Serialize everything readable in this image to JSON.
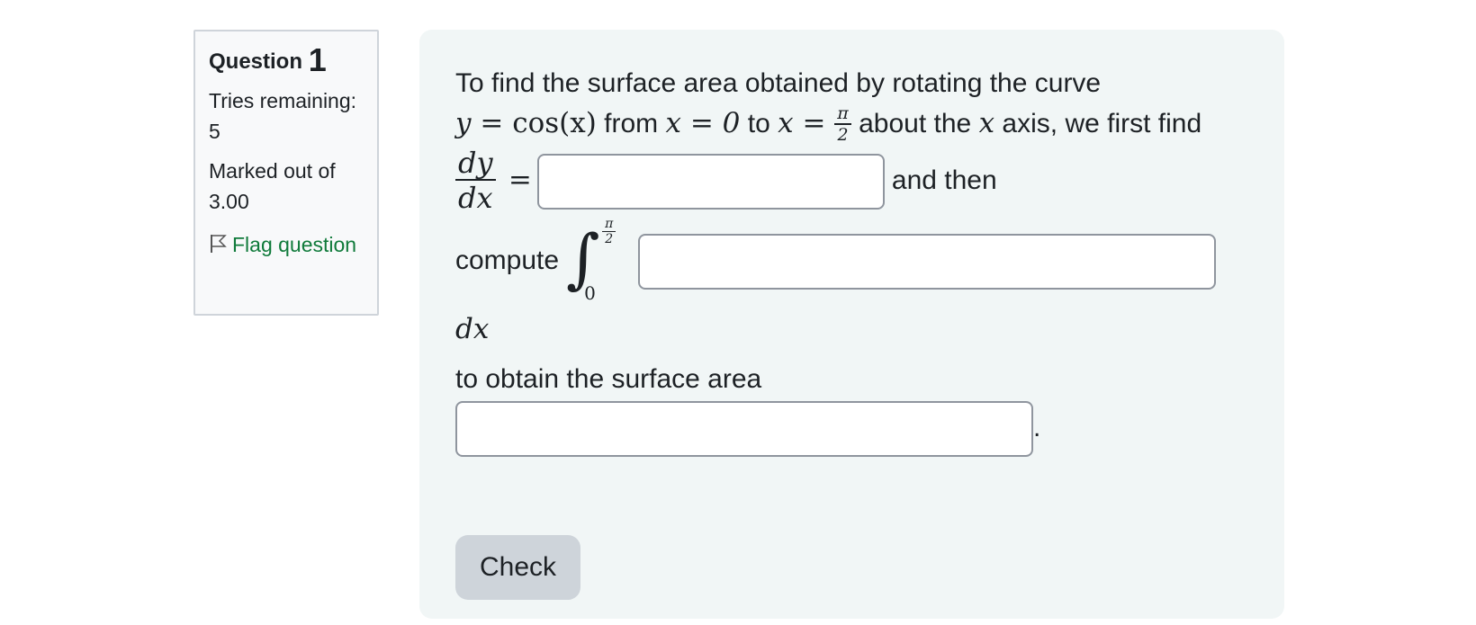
{
  "info": {
    "question_label": "Question",
    "question_number": "1",
    "tries_remaining": "Tries remaining: 5",
    "marked_out_of": "Marked out of 3.00",
    "flag_label": "Flag question",
    "flag_icon": "flag-icon",
    "link_color": "#0f7a3a"
  },
  "question": {
    "line1": "To find the surface area obtained by rotating the curve",
    "y_eq": "y = ",
    "cos_x": "cos(x)",
    "from": "from",
    "x_eq_0": "x = 0",
    "to": "to",
    "x_eq": "x = ",
    "pi": "π",
    "two": "2",
    "about_the": "about the",
    "x_var": "x",
    "axis_first_find": "axis, we first find",
    "dy": "dy",
    "dx": "dx",
    "equals": "=",
    "and_then": "and then",
    "compute": "compute",
    "lower_limit": "0",
    "dx_trailing": "dx",
    "obtain": "to obtain the surface area",
    "period": "."
  },
  "inputs": {
    "derivative_value": "",
    "integrand_value": "",
    "surface_area_value": ""
  },
  "check_button": "Check",
  "colors": {
    "content_bg": "#f1f6f6",
    "button_bg": "#ced4da",
    "info_bg": "#f8f9fa"
  }
}
